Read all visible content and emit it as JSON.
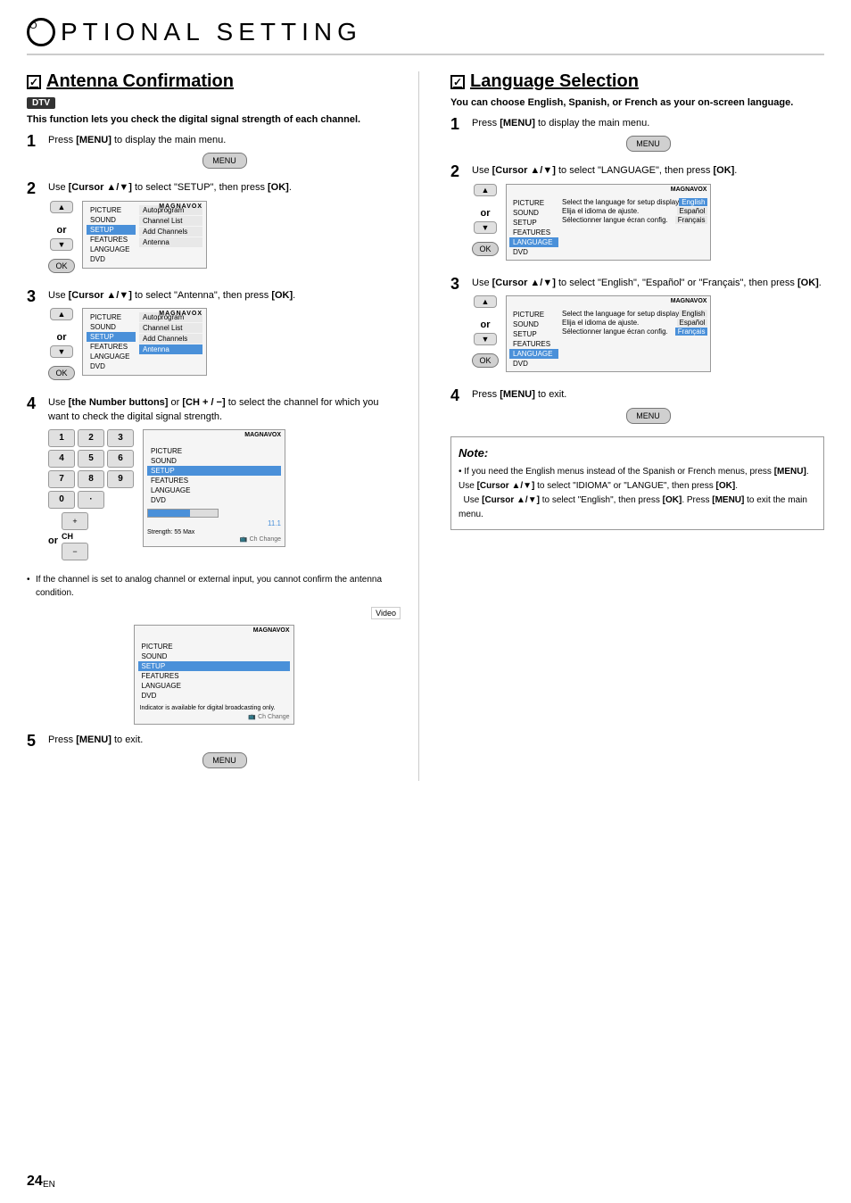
{
  "page": {
    "title": "PTIONAL   SETTING",
    "circle": "O"
  },
  "left": {
    "section_title": "Antenna Confirmation",
    "check": "✓",
    "dtv": "DTV",
    "desc": "This function lets you check the digital signal strength of each channel.",
    "steps": [
      {
        "number": "1",
        "text": "Press [MENU] to display the main menu.",
        "menu_label": "MENU"
      },
      {
        "number": "2",
        "text": "Use [Cursor ▲/▼] to select \"SETUP\", then press [OK].",
        "menu_items": [
          "PICTURE",
          "SOUND",
          "SETUP",
          "FEATURES",
          "LANGUAGE",
          "DVD"
        ],
        "right_items": [
          "Autoprogram",
          "Channel List",
          "Add Channels",
          "Antenna"
        ],
        "highlighted": "SETUP"
      },
      {
        "number": "3",
        "text": "Use [Cursor ▲/▼] to select \"Antenna\", then press [OK].",
        "menu_items": [
          "PICTURE",
          "SOUND",
          "SETUP",
          "FEATURES",
          "LANGUAGE",
          "DVD"
        ],
        "right_items": [
          "Autoprogram",
          "Channel List",
          "Add Channels",
          "Antenna"
        ],
        "highlighted_right": "Antenna"
      },
      {
        "number": "4",
        "text": "Use [the Number buttons] or [CH + / −] to select the channel for which you want to check the digital signal strength.",
        "num_buttons": [
          "1",
          "2",
          "3",
          "4",
          "5",
          "6",
          "7",
          "8",
          "9",
          "0",
          "·"
        ],
        "channel_value": "11.1",
        "signal_label": "Strength: 55 Max"
      }
    ],
    "bullet": "If the channel is set to analog channel or external input, you cannot confirm the antenna condition.",
    "video_badge": "Video",
    "step5": {
      "number": "5",
      "text": "Press [MENU] to exit.",
      "menu_label": "MENU"
    }
  },
  "right": {
    "section_title": "Language Selection",
    "check": "✓",
    "desc": "You can choose English, Spanish, or French as your on-screen language.",
    "steps": [
      {
        "number": "1",
        "text": "Press [MENU] to display the main menu.",
        "menu_label": "MENU"
      },
      {
        "number": "2",
        "text": "Use [Cursor ▲/▼] to select \"LANGUAGE\", then press [OK].",
        "menu_items": [
          "PICTURE",
          "SOUND",
          "SETUP",
          "FEATURES",
          "LANGUAGE",
          "DVD"
        ],
        "lang_options": [
          "Select the language for setup display",
          "Elija el idioma de ajuste.",
          "Sélectionner langue écran config."
        ],
        "lang_values": [
          "English",
          "Español",
          "Français"
        ],
        "highlighted": "LANGUAGE"
      },
      {
        "number": "3",
        "text": "Use [Cursor ▲/▼] to select \"English\", \"Español\" or \"Français\", then press [OK].",
        "menu_items": [
          "PICTURE",
          "SOUND",
          "SETUP",
          "FEATURES",
          "LANGUAGE",
          "DVD"
        ],
        "lang_options": [
          "Select the language for setup display",
          "Elija el idioma de ajuste.",
          "Sélectionner langue écran config."
        ],
        "lang_values": [
          "English",
          "Español",
          "Français"
        ],
        "highlighted_val": "Français"
      },
      {
        "number": "4",
        "text": "Press [MENU] to exit.",
        "menu_label": "MENU"
      }
    ],
    "note": {
      "title": "Note:",
      "text": "• If you need the English menus instead of the Spanish or French menus, press [MENU]. Use [Cursor ▲/▼] to select \"IDIOMA\" or \"LANGUE\", then press [OK].\n  Use [Cursor ▲/▼] to select \"English\", then press [OK]. Press [MENU] to exit the main menu."
    }
  },
  "footer": {
    "page_number": "24",
    "lang": "EN"
  }
}
